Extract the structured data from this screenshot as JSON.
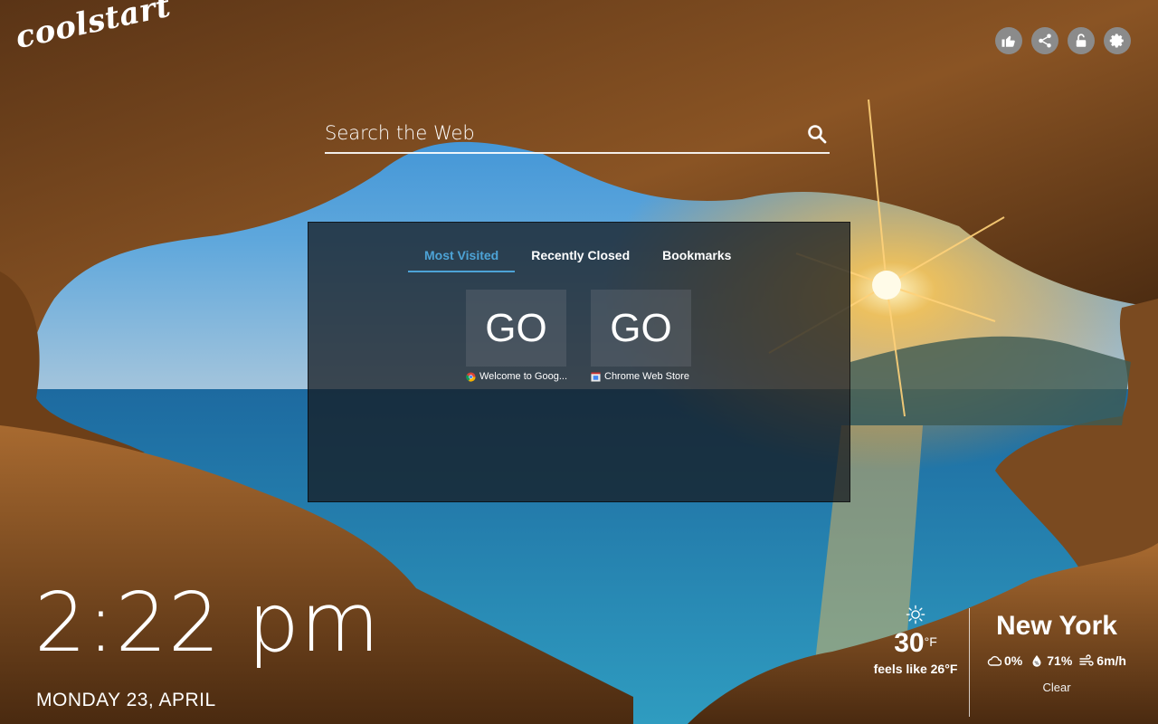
{
  "brand": {
    "logo_text": "coolstart"
  },
  "top_icons": [
    {
      "name": "thumbs-up-icon"
    },
    {
      "name": "share-icon"
    },
    {
      "name": "lock-icon"
    },
    {
      "name": "gear-icon"
    }
  ],
  "search": {
    "placeholder": "Search the Web",
    "icon": "search-icon"
  },
  "panel": {
    "tabs": [
      {
        "label": "Most Visited",
        "active": true
      },
      {
        "label": "Recently Closed",
        "active": false
      },
      {
        "label": "Bookmarks",
        "active": false
      }
    ],
    "tiles": [
      {
        "thumb_text": "GO",
        "label": "Welcome to Goog...",
        "favicon": "chrome-icon"
      },
      {
        "thumb_text": "GO",
        "label": "Chrome Web Store",
        "favicon": "web-store-icon"
      }
    ],
    "accent_color": "#4da3d6"
  },
  "clock": {
    "time": "2:22 pm",
    "date": "MONDAY 23, APRIL"
  },
  "weather": {
    "icon": "sun-icon",
    "temp": "30",
    "unit": "°F",
    "feels_like": "feels like 26°F",
    "city": "New York",
    "cloud": "0%",
    "humidity": "71%",
    "wind": "6m/h",
    "condition": "Clear"
  }
}
